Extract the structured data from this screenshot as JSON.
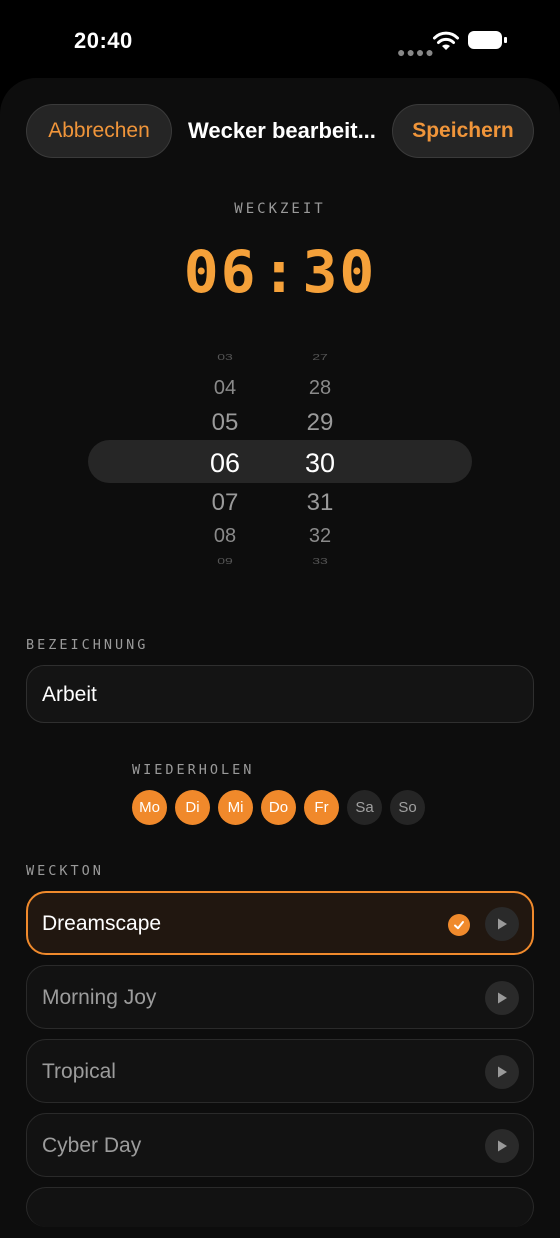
{
  "status_bar": {
    "time": "20:40",
    "signal_icon": "signal-dots-icon",
    "wifi_icon": "wifi-icon",
    "battery_icon": "battery-icon"
  },
  "header": {
    "cancel_label": "Abbrechen",
    "title": "Wecker bearbeit...",
    "save_label": "Speichern"
  },
  "alarm_time": {
    "label": "WECKZEIT",
    "hours": "06",
    "minutes": "30"
  },
  "picker": {
    "hours": [
      "03",
      "04",
      "05",
      "06",
      "07",
      "08",
      "09"
    ],
    "minutes": [
      "27",
      "28",
      "29",
      "30",
      "31",
      "32",
      "33"
    ],
    "selected_hour": "06",
    "selected_minute": "30"
  },
  "name_section": {
    "label": "BEZEICHNUNG",
    "value": "Arbeit"
  },
  "repeat": {
    "label": "WIEDERHOLEN",
    "days": [
      {
        "label": "Mo",
        "active": true
      },
      {
        "label": "Di",
        "active": true
      },
      {
        "label": "Mi",
        "active": true
      },
      {
        "label": "Do",
        "active": true
      },
      {
        "label": "Fr",
        "active": true
      },
      {
        "label": "Sa",
        "active": false
      },
      {
        "label": "So",
        "active": false
      }
    ]
  },
  "sound": {
    "label": "WECKTON",
    "tones": [
      {
        "name": "Dreamscape",
        "selected": true
      },
      {
        "name": "Morning Joy",
        "selected": false
      },
      {
        "name": "Tropical",
        "selected": false
      },
      {
        "name": "Cyber Day",
        "selected": false
      }
    ]
  },
  "colors": {
    "accent": "#f0892b",
    "background": "#000000",
    "surface": "#141414"
  }
}
